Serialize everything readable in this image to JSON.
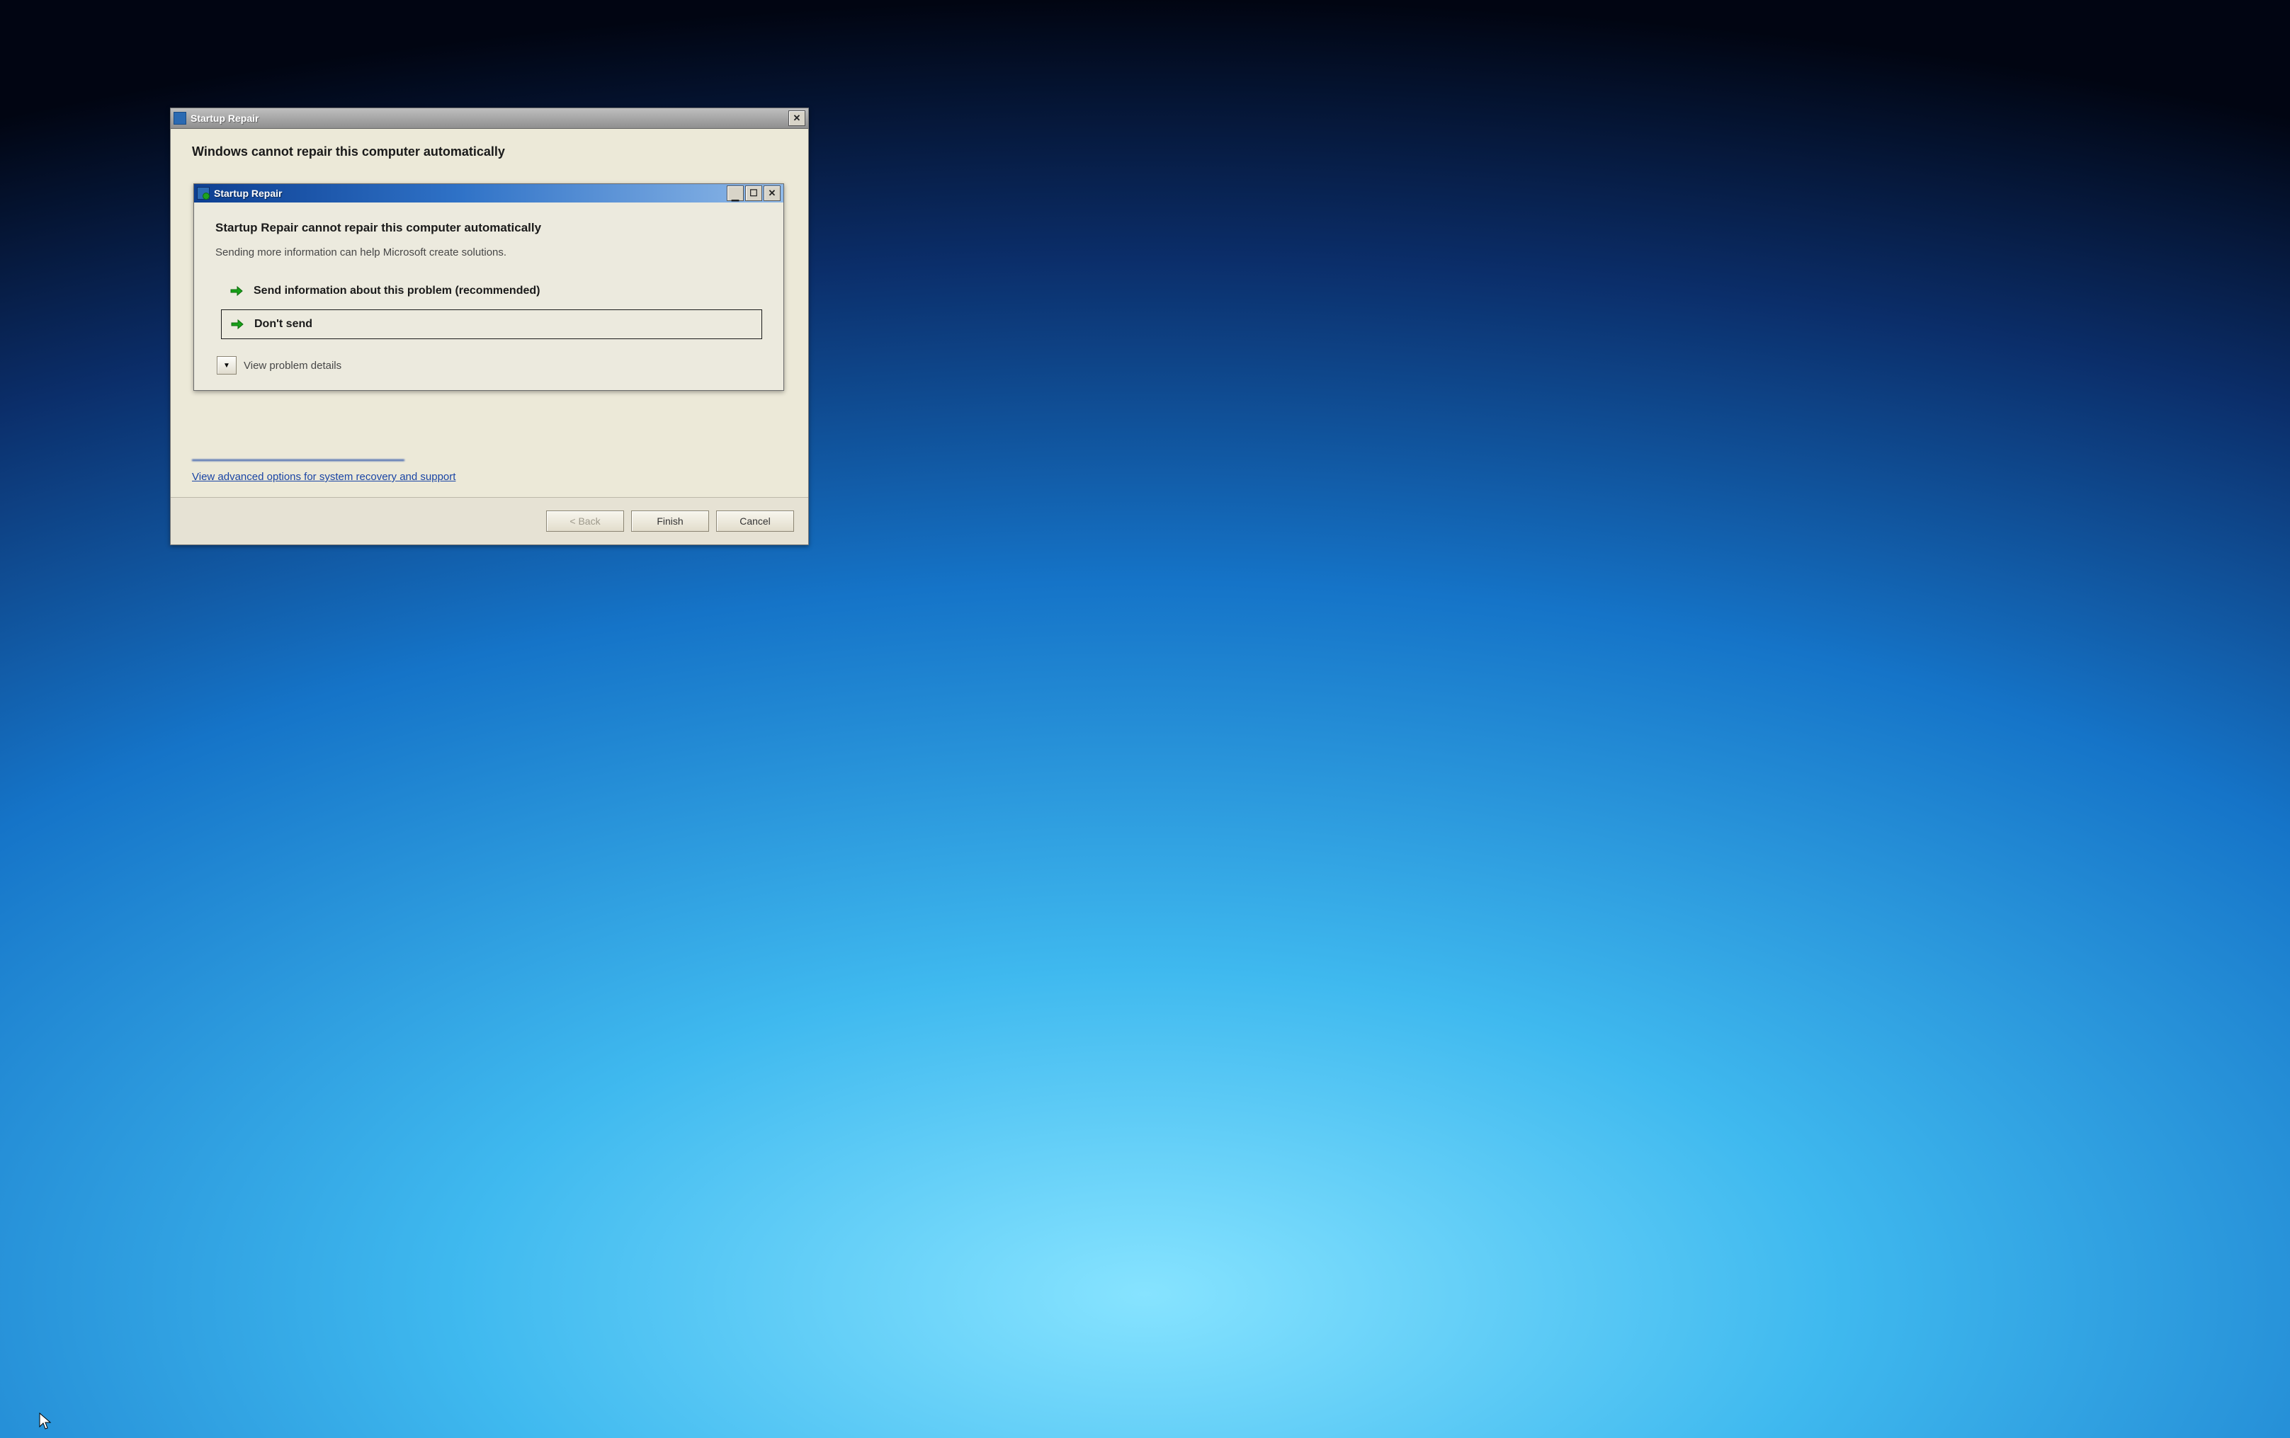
{
  "outer_window": {
    "title": "Startup Repair",
    "heading": "Windows cannot repair this computer automatically",
    "advanced_link": "View advanced options for system recovery and support",
    "footer": {
      "back": "< Back",
      "finish": "Finish",
      "cancel": "Cancel"
    }
  },
  "inner_window": {
    "title": "Startup Repair",
    "heading": "Startup Repair cannot repair this computer automatically",
    "subheading": "Sending more information can help Microsoft create solutions.",
    "options": [
      {
        "label": "Send information about this problem (recommended)"
      },
      {
        "label": "Don't send"
      }
    ],
    "details_toggle": "View problem details"
  }
}
